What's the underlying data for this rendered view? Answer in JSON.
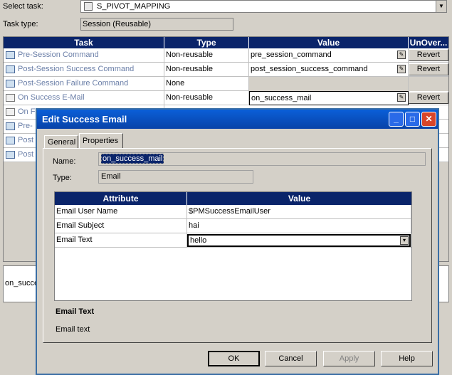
{
  "background": {
    "select_task_label": "Select task:",
    "select_task_value": "S_PIVOT_MAPPING",
    "task_type_label": "Task type:",
    "task_type_value": "Session (Reusable)",
    "columns": [
      "Task",
      "Type",
      "Value",
      "UnOver..."
    ],
    "rows": [
      {
        "task": "Pre-Session Command",
        "type": "Non-reusable",
        "value": "pre_session_command",
        "revert": "Revert"
      },
      {
        "task": "Post-Session Success Command",
        "type": "Non-reusable",
        "value": "post_session_success_command",
        "revert": "Revert"
      },
      {
        "task": "Post-Session Failure Command",
        "type": "None",
        "value": "",
        "revert": ""
      },
      {
        "task": "On Success E-Mail",
        "type": "Non-reusable",
        "value": "on_success_mail",
        "revert": "Revert"
      },
      {
        "task": "On F",
        "type": "",
        "value": "",
        "revert": ""
      },
      {
        "task": "Pre-",
        "type": "",
        "value": "",
        "revert": ""
      },
      {
        "task": "Post",
        "type": "",
        "value": "",
        "revert": ""
      },
      {
        "task": "Post",
        "type": "",
        "value": "",
        "revert": ""
      }
    ],
    "bottom_text": "on_succe"
  },
  "dialog": {
    "title": "Edit Success Email",
    "tabs": [
      "General",
      "Properties"
    ],
    "active_tab": "Properties",
    "name_label": "Name:",
    "name_value": "on_success_mail",
    "type_label": "Type:",
    "type_value": "Email",
    "attr_columns": [
      "Attribute",
      "Value"
    ],
    "attributes": [
      {
        "name": "Email User Name",
        "value": "$PMSuccessEmailUser"
      },
      {
        "name": "Email Subject",
        "value": "hai"
      },
      {
        "name": "Email Text",
        "value": "hello"
      }
    ],
    "desc_title": "Email Text",
    "desc_text": "Email text",
    "buttons": {
      "ok": "OK",
      "cancel": "Cancel",
      "apply": "Apply",
      "help": "Help"
    },
    "title_buttons": {
      "minimize": "_",
      "maximize": "□",
      "close": "✕"
    }
  }
}
